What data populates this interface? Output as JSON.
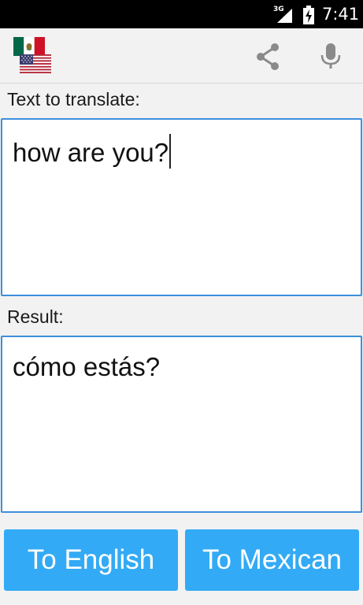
{
  "status_bar": {
    "network_type": "3G",
    "time": "7:41",
    "icons": [
      "signal-icon",
      "battery-charging-icon"
    ]
  },
  "action_bar": {
    "flags": [
      "mexico-flag-icon",
      "usa-flag-icon"
    ],
    "actions": [
      "share-icon",
      "microphone-icon"
    ]
  },
  "input": {
    "label": "Text to translate:",
    "value": "how are you?"
  },
  "result": {
    "label": "Result:",
    "value": "cómo estás?"
  },
  "buttons": {
    "to_english": "To English",
    "to_mexican": "To Mexican"
  },
  "colors": {
    "accent": "#33aaf5",
    "textbox_border": "#3c8fdc",
    "background": "#f2f2f2"
  }
}
